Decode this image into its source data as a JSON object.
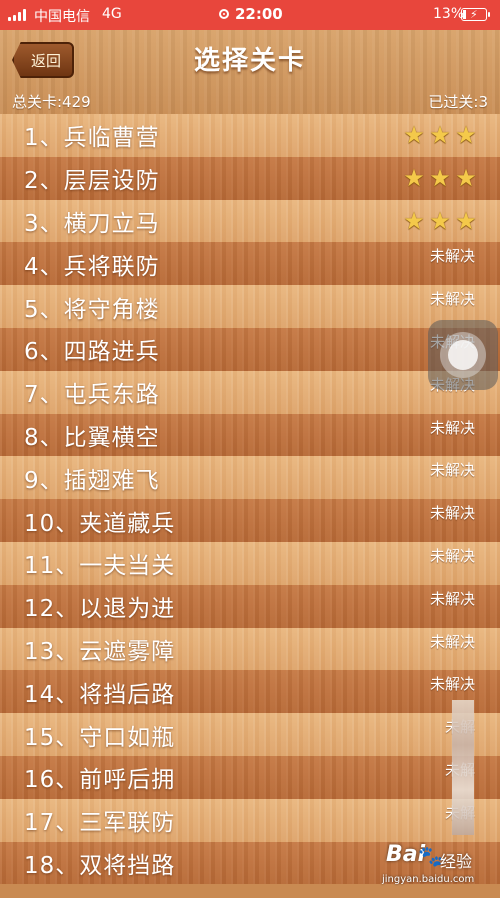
{
  "statusbar": {
    "carrier": "中国电信",
    "network": "4G",
    "time": "22:00",
    "battery": "13%",
    "battery_level": 0.13
  },
  "header": {
    "back_label": "返回",
    "title": "选择关卡",
    "total_levels": "总关卡:429",
    "passed_levels": "已过关:3"
  },
  "levels": [
    {
      "label": "1、兵临曹营",
      "status": "",
      "stars": 3
    },
    {
      "label": "2、层层设防",
      "status": "",
      "stars": 3
    },
    {
      "label": "3、横刀立马",
      "status": "",
      "stars": 3
    },
    {
      "label": "4、兵将联防",
      "status": "未解决",
      "stars": 0
    },
    {
      "label": "5、将守角楼",
      "status": "未解决",
      "stars": 0
    },
    {
      "label": "6、四路进兵",
      "status": "未解决",
      "stars": 0
    },
    {
      "label": "7、屯兵东路",
      "status": "未解决",
      "stars": 0
    },
    {
      "label": "8、比翼横空",
      "status": "未解决",
      "stars": 0
    },
    {
      "label": "9、插翅难飞",
      "status": "未解决",
      "stars": 0
    },
    {
      "label": "10、夹道藏兵",
      "status": "未解决",
      "stars": 0
    },
    {
      "label": "11、一夫当关",
      "status": "未解决",
      "stars": 0
    },
    {
      "label": "12、以退为进",
      "status": "未解决",
      "stars": 0
    },
    {
      "label": "13、云遮雾障",
      "status": "未解决",
      "stars": 0
    },
    {
      "label": "14、将挡后路",
      "status": "未解决",
      "stars": 0
    },
    {
      "label": "15、守口如瓶",
      "status": "未解",
      "stars": 0
    },
    {
      "label": "16、前呼后拥",
      "status": "未解",
      "stars": 0
    },
    {
      "label": "17、三军联防",
      "status": "未解",
      "stars": 0
    },
    {
      "label": "18、双将挡路",
      "status": "",
      "stars": 0
    }
  ],
  "watermark": {
    "logo": "Bai",
    "jingyan": "经验",
    "url": "jingyan.baidu.com"
  },
  "icons": {
    "star": "star-icon",
    "assistive": "assistive-touch-icon"
  },
  "colors": {
    "statusbar": "#e8463c",
    "star": "#f4c94a",
    "row_light": "#e4ad73",
    "row_dark": "#bf733f"
  }
}
